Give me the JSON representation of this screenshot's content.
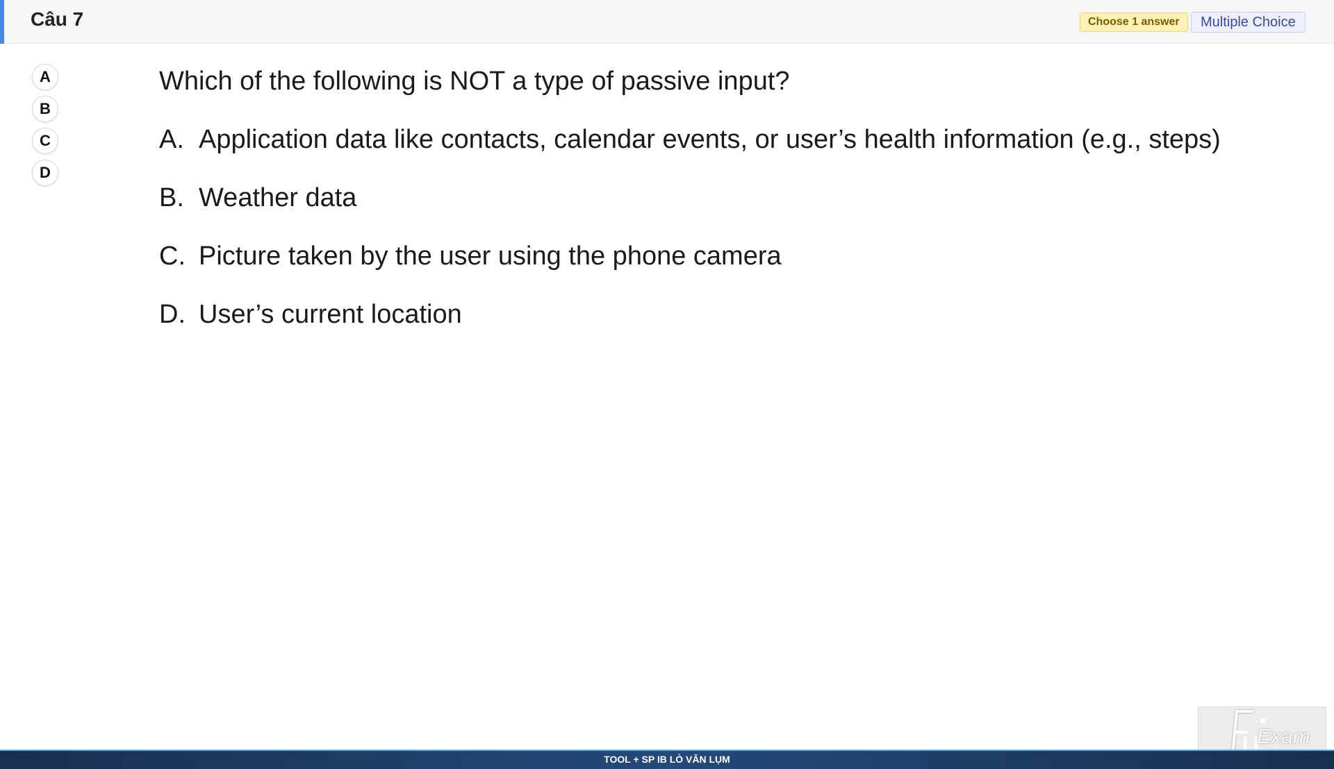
{
  "header": {
    "question_number": "Câu 7",
    "instruction_badge": "Choose 1 answer",
    "type_badge": "Multiple Choice",
    "accent_color": "#4a86e8"
  },
  "answer_buttons": [
    "A",
    "B",
    "C",
    "D"
  ],
  "question": {
    "stem": "Which of the following is NOT a type of passive input?",
    "options": [
      {
        "letter": "A.",
        "text": "Application data like contacts, calendar events, or user’s health information (e.g., steps)"
      },
      {
        "letter": "B.",
        "text": "Weather data"
      },
      {
        "letter": "C.",
        "text": "Picture taken by the user using the phone camera"
      },
      {
        "letter": "D.",
        "text": "User’s current location"
      }
    ]
  },
  "watermark": {
    "text": "Exam",
    "icon": "fu-logo-icon"
  },
  "footer": {
    "text": "TOOL + SP IB LÒ VĂN LỤM"
  }
}
